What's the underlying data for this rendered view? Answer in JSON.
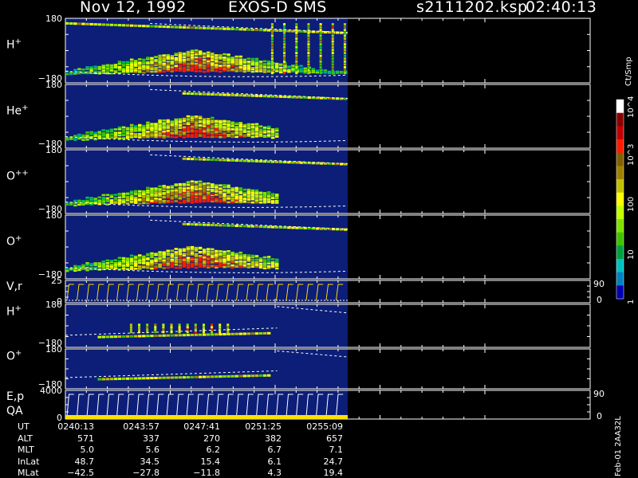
{
  "header": {
    "date": "Nov 12, 1992",
    "instrument": "EXOS-D SMS",
    "file": "s2111202.ksp",
    "time": "02:40:13"
  },
  "colors": {
    "background": "#000000",
    "plot_bg": "#0c1e78",
    "trace": "#ffffff",
    "vr_trace": "#ffd800",
    "qa_bar": "#ffe000"
  },
  "colorbar": {
    "units": "Ct/Smp",
    "labels": [
      "10^4",
      "10^3",
      "100",
      "10",
      "1"
    ],
    "scale": "log",
    "colors": [
      "#ffffff",
      "#8b0000",
      "#c00000",
      "#ff1a00",
      "#806000",
      "#a08000",
      "#c0c000",
      "#ffff00",
      "#c0ff00",
      "#80e000",
      "#40c000",
      "#00a040",
      "#00c0c0",
      "#0080c0",
      "#0000b0"
    ]
  },
  "panels": [
    {
      "id": "h-plus",
      "label": "H",
      "sup": "+",
      "top_tick": "180",
      "bottom_tick": "−180",
      "right_tick": ""
    },
    {
      "id": "he-plus",
      "label": "He",
      "sup": "+",
      "top_tick": "180",
      "bottom_tick": "−180",
      "right_tick": ""
    },
    {
      "id": "o-plus-plus",
      "label": "O",
      "sup": "++",
      "top_tick": "180",
      "bottom_tick": "−180",
      "right_tick": ""
    },
    {
      "id": "o-plus",
      "label": "O",
      "sup": "+",
      "top_tick": "180",
      "bottom_tick": "−180",
      "right_tick": ""
    },
    {
      "id": "vr",
      "label": "V,r",
      "sup": "",
      "top_tick": "25",
      "bottom_tick": "0",
      "right_top": "90",
      "right_bottom": "0"
    },
    {
      "id": "h-plus-2",
      "label": "H",
      "sup": "+",
      "top_tick": "180",
      "bottom_tick": "−180",
      "right_tick": ""
    },
    {
      "id": "o-plus-2",
      "label": "O",
      "sup": "+",
      "top_tick": "180",
      "bottom_tick": "−180",
      "right_tick": ""
    },
    {
      "id": "ep-qa",
      "label": "E,p",
      "label2": "QA",
      "sup": "",
      "top_tick": "4000",
      "bottom_tick": "0",
      "right_top": "90",
      "right_bottom": "0"
    }
  ],
  "footer": {
    "rows": [
      {
        "name": "UT",
        "values": [
          "0240:13",
          "0243:57",
          "0247:41",
          "0251:25",
          "0255:09"
        ]
      },
      {
        "name": "ALT",
        "values": [
          "571",
          "337",
          "270",
          "382",
          "657"
        ]
      },
      {
        "name": "MLT",
        "values": [
          "5.0",
          "5.6",
          "6.2",
          "6.7",
          "7.1"
        ]
      },
      {
        "name": "InLat",
        "values": [
          "48.7",
          "34.5",
          "15.4",
          "6.1",
          "24.7"
        ]
      },
      {
        "name": "MLat",
        "values": [
          "−42.5",
          "−27.8",
          "−11.8",
          "4.3",
          "19.4"
        ]
      }
    ],
    "version": "Feb-01 2AA32L"
  },
  "chart_data": {
    "type": "heatmap",
    "title": "Nov 12, 1992   EXOS-D SMS",
    "x": [
      "0240:13",
      "0243:57",
      "0247:41",
      "0251:25",
      "0255:09"
    ],
    "xlabel": "UT",
    "data_end_fraction_of_axis": 0.53,
    "series": [
      {
        "name": "H+",
        "ylim": [
          -180,
          180
        ]
      },
      {
        "name": "He+",
        "ylim": [
          -180,
          180
        ]
      },
      {
        "name": "O++",
        "ylim": [
          -180,
          180
        ]
      },
      {
        "name": "O+",
        "ylim": [
          -180,
          180
        ]
      },
      {
        "name": "V,r",
        "ylim": [
          0,
          25
        ],
        "right_ylim": [
          0,
          90
        ]
      },
      {
        "name": "H+",
        "ylim": [
          -180,
          180
        ]
      },
      {
        "name": "O+",
        "ylim": [
          -180,
          180
        ]
      },
      {
        "name": "E,p",
        "ylim": [
          0,
          4000
        ],
        "right_ylim": [
          0,
          90
        ]
      }
    ],
    "colorbar_range": [
      1,
      10000
    ],
    "colorbar_scale": "log",
    "colorbar_units": "Ct/Smp"
  }
}
